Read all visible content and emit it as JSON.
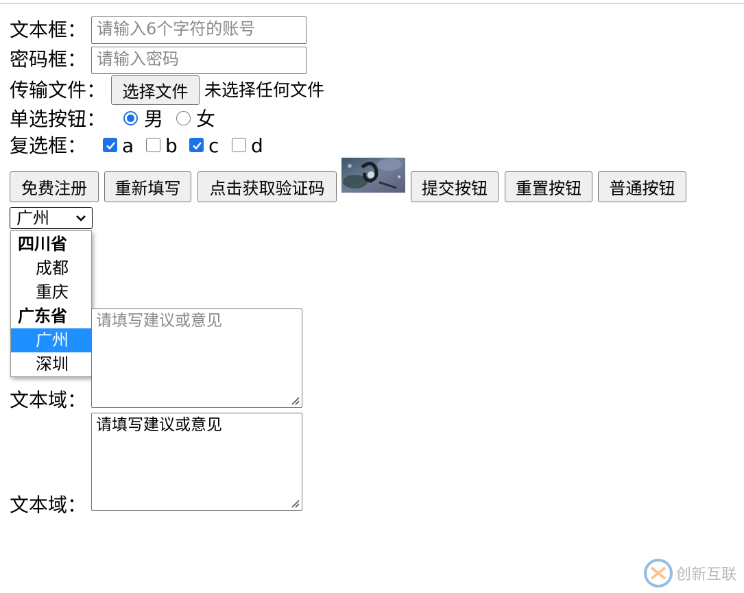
{
  "form": {
    "text_label": "文本框：",
    "text_placeholder": "请输入6个字符的账号",
    "password_label": "密码框：",
    "password_placeholder": "请输入密码",
    "file_label": "传输文件：",
    "file_button": "选择文件",
    "file_status": "未选择任何文件",
    "radio_label": "单选按钮：",
    "radio_options": [
      {
        "label": "男",
        "checked": true
      },
      {
        "label": "女",
        "checked": false
      }
    ],
    "checkbox_label": "复选框：",
    "checkbox_options": [
      {
        "label": "a",
        "checked": true
      },
      {
        "label": "b",
        "checked": false
      },
      {
        "label": "c",
        "checked": true
      },
      {
        "label": "d",
        "checked": false
      }
    ]
  },
  "buttons": {
    "register": "免费注册",
    "refill": "重新填写",
    "captcha": "点击获取验证码",
    "submit": "提交按钮",
    "reset": "重置按钮",
    "normal": "普通按钮"
  },
  "select": {
    "value": "广州",
    "groups": [
      {
        "label": "四川省",
        "options": [
          "成都",
          "重庆"
        ]
      },
      {
        "label": "广东省",
        "options": [
          "广州",
          "深圳"
        ]
      }
    ],
    "highlighted": "广州"
  },
  "textareas": [
    {
      "label": "文本域：",
      "placeholder": "请填写建议或意见",
      "value": ""
    },
    {
      "label": "文本域：",
      "placeholder": "",
      "value": "请填写建议或意见"
    }
  ],
  "watermark": {
    "text": "创新互联"
  },
  "colors": {
    "accent": "#1a73e8",
    "selection": "#1e90ff",
    "border": "#767676",
    "button_bg": "#efefef"
  }
}
